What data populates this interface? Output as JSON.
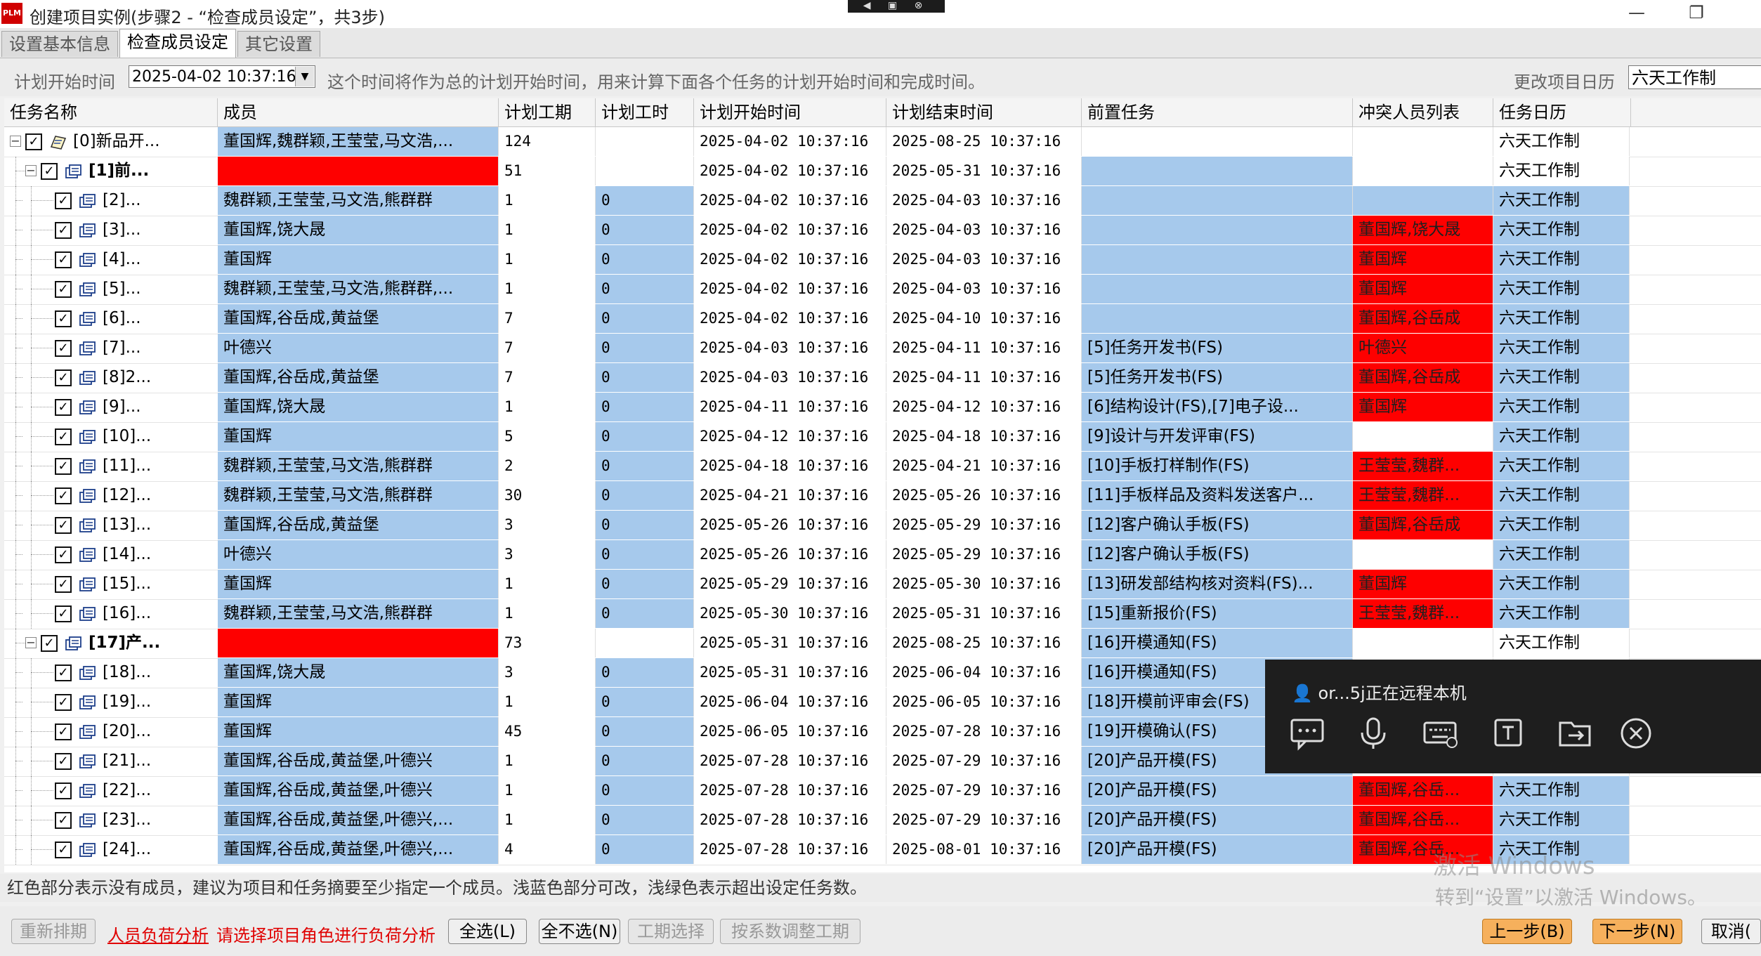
{
  "window": {
    "app_icon_text": "PLM",
    "title": "创建项目实例(步骤2 - “检查成员设定”，共3步)",
    "remote_strip_icons": "◀ ▣ ⊗",
    "buttons": [
      "—",
      "❐"
    ]
  },
  "tabs": [
    {
      "label": "设置基本信息",
      "active": false
    },
    {
      "label": "检查成员设定",
      "active": true
    },
    {
      "label": "其它设置",
      "active": false
    }
  ],
  "toolbar": {
    "start_label": "计划开始时间",
    "start_value": "2025-04-02 10:37:16",
    "hint": "这个时间将作为总的计划开始时间，用来计算下面各个任务的计划开始时间和完成时间。",
    "calendar_label": "更改项目日历",
    "calendar_value": "六天工作制"
  },
  "columns": [
    "任务名称",
    "成员",
    "计划工期",
    "计划工时",
    "计划开始时间",
    "计划结束时间",
    "前置任务",
    "冲突人员列表",
    "任务日历"
  ],
  "rows": [
    {
      "name": "[0]新品开...",
      "level": 0,
      "bold": false,
      "members": "董国辉,魏群颖,王莹莹,马文浩,...",
      "members_status": "blue",
      "duration": "124",
      "hours": "",
      "hours_status": "white",
      "start": "2025-04-02 10:37:16",
      "end": "2025-08-25 10:37:16",
      "pred": "",
      "pred_status": "white",
      "conflict": "",
      "conflict_status": "white",
      "calendar": "六天工作制",
      "cal_status": "white"
    },
    {
      "name": "[1]前...",
      "level": 1,
      "bold": true,
      "members": "",
      "members_status": "red",
      "duration": "51",
      "hours": "",
      "hours_status": "white",
      "start": "2025-04-02 10:37:16",
      "end": "2025-05-31 10:37:16",
      "pred": "",
      "pred_status": "blue",
      "conflict": "",
      "conflict_status": "white",
      "calendar": "六天工作制",
      "cal_status": "white"
    },
    {
      "name": "[2]...",
      "level": 2,
      "bold": false,
      "members": "魏群颖,王莹莹,马文浩,熊群群",
      "members_status": "blue",
      "duration": "1",
      "hours": "0",
      "hours_status": "blue",
      "start": "2025-04-02 10:37:16",
      "end": "2025-04-03 10:37:16",
      "pred": "",
      "pred_status": "blue",
      "conflict": "",
      "conflict_status": "blue",
      "calendar": "六天工作制",
      "cal_status": "blue"
    },
    {
      "name": "[3]...",
      "level": 2,
      "bold": false,
      "members": "董国辉,饶大晟",
      "members_status": "blue",
      "duration": "1",
      "hours": "0",
      "hours_status": "blue",
      "start": "2025-04-02 10:37:16",
      "end": "2025-04-03 10:37:16",
      "pred": "",
      "pred_status": "blue",
      "conflict": "董国辉,饶大晟",
      "conflict_status": "red",
      "calendar": "六天工作制",
      "cal_status": "blue"
    },
    {
      "name": "[4]...",
      "level": 2,
      "bold": false,
      "members": "董国辉",
      "members_status": "blue",
      "duration": "1",
      "hours": "0",
      "hours_status": "blue",
      "start": "2025-04-02 10:37:16",
      "end": "2025-04-03 10:37:16",
      "pred": "",
      "pred_status": "blue",
      "conflict": "董国辉",
      "conflict_status": "red",
      "calendar": "六天工作制",
      "cal_status": "blue"
    },
    {
      "name": "[5]...",
      "level": 2,
      "bold": false,
      "members": "魏群颖,王莹莹,马文浩,熊群群,...",
      "members_status": "blue",
      "duration": "1",
      "hours": "0",
      "hours_status": "blue",
      "start": "2025-04-02 10:37:16",
      "end": "2025-04-03 10:37:16",
      "pred": "",
      "pred_status": "blue",
      "conflict": "董国辉",
      "conflict_status": "red",
      "calendar": "六天工作制",
      "cal_status": "blue"
    },
    {
      "name": "[6]...",
      "level": 2,
      "bold": false,
      "members": "董国辉,谷岳成,黄益堡",
      "members_status": "blue",
      "duration": "7",
      "hours": "0",
      "hours_status": "blue",
      "start": "2025-04-02 10:37:16",
      "end": "2025-04-10 10:37:16",
      "pred": "",
      "pred_status": "blue",
      "conflict": "董国辉,谷岳成",
      "conflict_status": "red",
      "calendar": "六天工作制",
      "cal_status": "blue"
    },
    {
      "name": "[7]...",
      "level": 2,
      "bold": false,
      "members": "叶德兴",
      "members_status": "blue",
      "duration": "7",
      "hours": "0",
      "hours_status": "blue",
      "start": "2025-04-03 10:37:16",
      "end": "2025-04-11 10:37:16",
      "pred": "[5]任务开发书(FS)",
      "pred_status": "blue",
      "conflict": "叶德兴",
      "conflict_status": "red",
      "calendar": "六天工作制",
      "cal_status": "blue"
    },
    {
      "name": "[8]2...",
      "level": 2,
      "bold": false,
      "members": "董国辉,谷岳成,黄益堡",
      "members_status": "blue",
      "duration": "7",
      "hours": "0",
      "hours_status": "blue",
      "start": "2025-04-03 10:37:16",
      "end": "2025-04-11 10:37:16",
      "pred": "[5]任务开发书(FS)",
      "pred_status": "blue",
      "conflict": "董国辉,谷岳成",
      "conflict_status": "red",
      "calendar": "六天工作制",
      "cal_status": "blue"
    },
    {
      "name": "[9]...",
      "level": 2,
      "bold": false,
      "members": "董国辉,饶大晟",
      "members_status": "blue",
      "duration": "1",
      "hours": "0",
      "hours_status": "blue",
      "start": "2025-04-11 10:37:16",
      "end": "2025-04-12 10:37:16",
      "pred": "[6]结构设计(FS),[7]电子设...",
      "pred_status": "blue",
      "conflict": "董国辉",
      "conflict_status": "red",
      "calendar": "六天工作制",
      "cal_status": "blue"
    },
    {
      "name": "[10]...",
      "level": 2,
      "bold": false,
      "members": "董国辉",
      "members_status": "blue",
      "duration": "5",
      "hours": "0",
      "hours_status": "blue",
      "start": "2025-04-12 10:37:16",
      "end": "2025-04-18 10:37:16",
      "pred": "[9]设计与开发评审(FS)",
      "pred_status": "blue",
      "conflict": "",
      "conflict_status": "white",
      "calendar": "六天工作制",
      "cal_status": "blue"
    },
    {
      "name": "[11]...",
      "level": 2,
      "bold": false,
      "members": "魏群颖,王莹莹,马文浩,熊群群",
      "members_status": "blue",
      "duration": "2",
      "hours": "0",
      "hours_status": "blue",
      "start": "2025-04-18 10:37:16",
      "end": "2025-04-21 10:37:16",
      "pred": "[10]手板打样制作(FS)",
      "pred_status": "blue",
      "conflict": "王莹莹,魏群...",
      "conflict_status": "red",
      "calendar": "六天工作制",
      "cal_status": "blue"
    },
    {
      "name": "[12]...",
      "level": 2,
      "bold": false,
      "members": "魏群颖,王莹莹,马文浩,熊群群",
      "members_status": "blue",
      "duration": "30",
      "hours": "0",
      "hours_status": "blue",
      "start": "2025-04-21 10:37:16",
      "end": "2025-05-26 10:37:16",
      "pred": "[11]手板样品及资料发送客户...",
      "pred_status": "blue",
      "conflict": "王莹莹,魏群...",
      "conflict_status": "red",
      "calendar": "六天工作制",
      "cal_status": "blue"
    },
    {
      "name": "[13]...",
      "level": 2,
      "bold": false,
      "members": "董国辉,谷岳成,黄益堡",
      "members_status": "blue",
      "duration": "3",
      "hours": "0",
      "hours_status": "blue",
      "start": "2025-05-26 10:37:16",
      "end": "2025-05-29 10:37:16",
      "pred": "[12]客户确认手板(FS)",
      "pred_status": "blue",
      "conflict": "董国辉,谷岳成",
      "conflict_status": "red",
      "calendar": "六天工作制",
      "cal_status": "blue"
    },
    {
      "name": "[14]...",
      "level": 2,
      "bold": false,
      "members": "叶德兴",
      "members_status": "blue",
      "duration": "3",
      "hours": "0",
      "hours_status": "blue",
      "start": "2025-05-26 10:37:16",
      "end": "2025-05-29 10:37:16",
      "pred": "[12]客户确认手板(FS)",
      "pred_status": "blue",
      "conflict": "",
      "conflict_status": "white",
      "calendar": "六天工作制",
      "cal_status": "blue"
    },
    {
      "name": "[15]...",
      "level": 2,
      "bold": false,
      "members": "董国辉",
      "members_status": "blue",
      "duration": "1",
      "hours": "0",
      "hours_status": "blue",
      "start": "2025-05-29 10:37:16",
      "end": "2025-05-30 10:37:16",
      "pred": "[13]研发部结构核对资料(FS)...",
      "pred_status": "blue",
      "conflict": "董国辉",
      "conflict_status": "red",
      "calendar": "六天工作制",
      "cal_status": "blue"
    },
    {
      "name": "[16]...",
      "level": 2,
      "bold": false,
      "members": "魏群颖,王莹莹,马文浩,熊群群",
      "members_status": "blue",
      "duration": "1",
      "hours": "0",
      "hours_status": "blue",
      "start": "2025-05-30 10:37:16",
      "end": "2025-05-31 10:37:16",
      "pred": "[15]重新报价(FS)",
      "pred_status": "blue",
      "conflict": "王莹莹,魏群...",
      "conflict_status": "red",
      "calendar": "六天工作制",
      "cal_status": "blue"
    },
    {
      "name": "[17]产...",
      "level": 1,
      "bold": true,
      "members": "",
      "members_status": "red",
      "duration": "73",
      "hours": "",
      "hours_status": "white",
      "start": "2025-05-31 10:37:16",
      "end": "2025-08-25 10:37:16",
      "pred": "[16]开模通知(FS)",
      "pred_status": "blue",
      "conflict": "",
      "conflict_status": "white",
      "calendar": "六天工作制",
      "cal_status": "white"
    },
    {
      "name": "[18]...",
      "level": 2,
      "bold": false,
      "members": "董国辉,饶大晟",
      "members_status": "blue",
      "duration": "3",
      "hours": "0",
      "hours_status": "blue",
      "start": "2025-05-31 10:37:16",
      "end": "2025-06-04 10:37:16",
      "pred": "[16]开模通知(FS)",
      "pred_status": "blue",
      "conflict": "",
      "conflict_status": "white",
      "calendar": "",
      "cal_status": "white"
    },
    {
      "name": "[19]...",
      "level": 2,
      "bold": false,
      "members": "董国辉",
      "members_status": "blue",
      "duration": "1",
      "hours": "0",
      "hours_status": "blue",
      "start": "2025-06-04 10:37:16",
      "end": "2025-06-05 10:37:16",
      "pred": "[18]开模前评审会(FS)",
      "pred_status": "blue",
      "conflict": "",
      "conflict_status": "white",
      "calendar": "",
      "cal_status": "white"
    },
    {
      "name": "[20]...",
      "level": 2,
      "bold": false,
      "members": "董国辉",
      "members_status": "blue",
      "duration": "45",
      "hours": "0",
      "hours_status": "blue",
      "start": "2025-06-05 10:37:16",
      "end": "2025-07-28 10:37:16",
      "pred": "[19]开模确认(FS)",
      "pred_status": "blue",
      "conflict": "",
      "conflict_status": "white",
      "calendar": "",
      "cal_status": "white"
    },
    {
      "name": "[21]...",
      "level": 2,
      "bold": false,
      "members": "董国辉,谷岳成,黄益堡,叶德兴",
      "members_status": "blue",
      "duration": "1",
      "hours": "0",
      "hours_status": "blue",
      "start": "2025-07-28 10:37:16",
      "end": "2025-07-29 10:37:16",
      "pred": "[20]产品开模(FS)",
      "pred_status": "blue",
      "conflict": "",
      "conflict_status": "white",
      "calendar": "",
      "cal_status": "white"
    },
    {
      "name": "[22]...",
      "level": 2,
      "bold": false,
      "members": "董国辉,谷岳成,黄益堡,叶德兴",
      "members_status": "blue",
      "duration": "1",
      "hours": "0",
      "hours_status": "blue",
      "start": "2025-07-28 10:37:16",
      "end": "2025-07-29 10:37:16",
      "pred": "[20]产品开模(FS)",
      "pred_status": "blue",
      "conflict": "董国辉,谷岳...",
      "conflict_status": "red",
      "calendar": "六天工作制",
      "cal_status": "blue"
    },
    {
      "name": "[23]...",
      "level": 2,
      "bold": false,
      "members": "董国辉,谷岳成,黄益堡,叶德兴,...",
      "members_status": "blue",
      "duration": "1",
      "hours": "0",
      "hours_status": "blue",
      "start": "2025-07-28 10:37:16",
      "end": "2025-07-29 10:37:16",
      "pred": "[20]产品开模(FS)",
      "pred_status": "blue",
      "conflict": "董国辉,谷岳...",
      "conflict_status": "red",
      "calendar": "六天工作制",
      "cal_status": "blue"
    },
    {
      "name": "[24]...",
      "level": 2,
      "bold": false,
      "members": "董国辉,谷岳成,黄益堡,叶德兴,...",
      "members_status": "blue",
      "duration": "4",
      "hours": "0",
      "hours_status": "blue",
      "start": "2025-07-28 10:37:16",
      "end": "2025-08-01 10:37:16",
      "pred": "[20]产品开模(FS)",
      "pred_status": "blue",
      "conflict": "董国辉,谷岳...",
      "conflict_status": "red",
      "calendar": "六天工作制",
      "cal_status": "blue"
    }
  ],
  "status_text": "红色部分表示没有成员，建议为项目和任务摘要至少指定一个成员。浅蓝色部分可改，浅绿色表示超出设定任务数。",
  "bottom": {
    "reschedule": "重新排期",
    "load_analysis_link": "人员负荷分析",
    "load_hint": "请选择项目角色进行负荷分析",
    "select_all": "全选(L)",
    "select_none": "全不选(N)",
    "duration_select": "工期选择",
    "coef_adjust": "按系数调整工期",
    "prev": "上一步(B)",
    "next": "下一步(N)",
    "cancel": "取消("
  },
  "remote_panel": {
    "user_text": "or...5j正在远程本机",
    "icons": [
      "chat-icon",
      "microphone-icon",
      "keyboard-icon",
      "text-icon",
      "file-transfer-icon",
      "close-icon"
    ]
  },
  "watermark": {
    "line1": "激活 Windows",
    "line2": "转到“设置”以激活 Windows。"
  },
  "colors": {
    "red": "#fe0000",
    "blue": "#a6c9ec",
    "orange_button": "#f6b05c"
  }
}
